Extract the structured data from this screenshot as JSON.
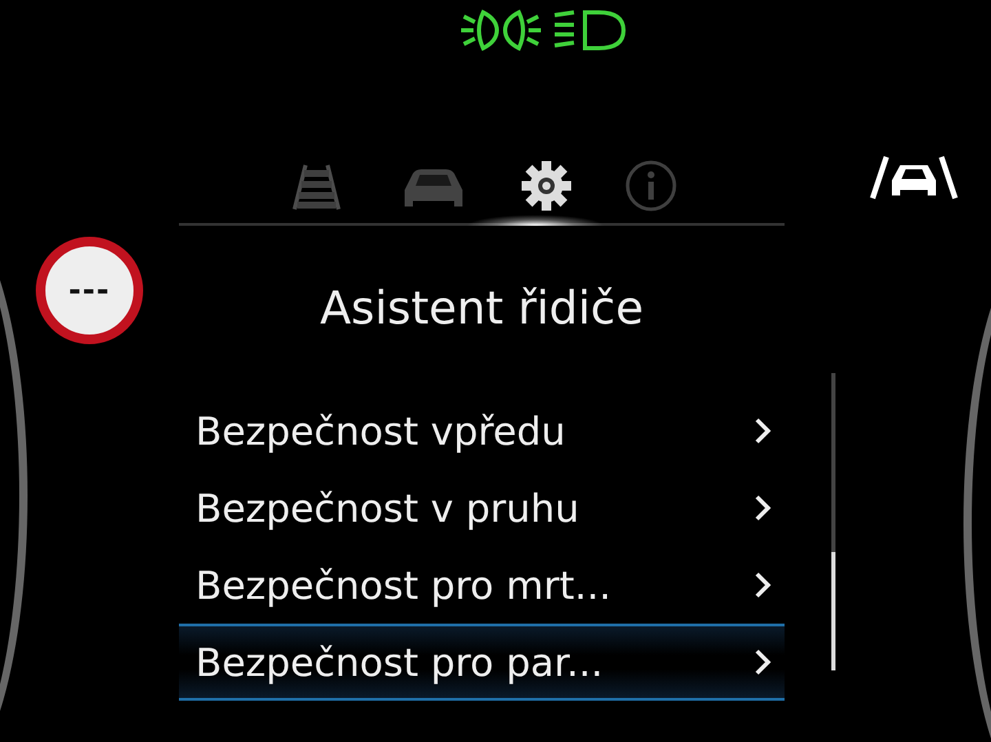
{
  "tabs": [
    {
      "kind": "road",
      "selected": false
    },
    {
      "kind": "car",
      "selected": false
    },
    {
      "kind": "settings",
      "selected": true
    },
    {
      "kind": "info",
      "selected": false
    }
  ],
  "speed_limit_sign": {
    "text": "---"
  },
  "title": "Asistent řidiče",
  "menu": [
    {
      "label": "Bezpečnost vpředu",
      "selected": false
    },
    {
      "label": "Bezpečnost v pruhu",
      "selected": false
    },
    {
      "label": "Bezpečnost pro mrt...",
      "selected": false
    },
    {
      "label": "Bezpečnost pro par...",
      "selected": true
    }
  ]
}
